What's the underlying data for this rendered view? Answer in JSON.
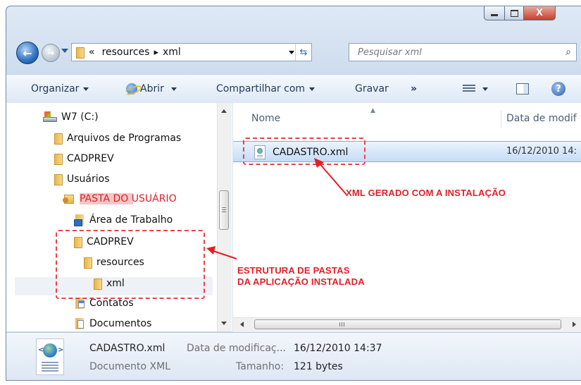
{
  "window": {
    "minimize_label": "–",
    "maximize_label": "□",
    "close_label": "X"
  },
  "address_bar": {
    "overflow": "«",
    "segments": [
      "resources",
      "xml"
    ],
    "search_placeholder": "Pesquisar xml"
  },
  "toolbar": {
    "organize": "Organizar",
    "open": "Abrir",
    "share": "Compartilhar com",
    "burn": "Gravar",
    "more": "»"
  },
  "nav_tree": [
    {
      "label": "W7 (C:)",
      "icon": "drive-icon",
      "level": 0
    },
    {
      "label": "Arquivos de Programas",
      "icon": "folder-icon",
      "level": 1
    },
    {
      "label": "CADPREV",
      "icon": "folder-icon",
      "level": 1
    },
    {
      "label": "Usuários",
      "icon": "folder-icon",
      "level": 1
    },
    {
      "label": "PASTA DO USUÁRIO",
      "icon": "user-folder-icon",
      "level": 2
    },
    {
      "label": "Área de Trabalho",
      "icon": "desktop-folder-icon",
      "level": 3
    },
    {
      "label": "CADPREV",
      "icon": "folder-icon",
      "level": 3
    },
    {
      "label": "resources",
      "icon": "folder-icon",
      "level": 4
    },
    {
      "label": "xml",
      "icon": "folder-icon",
      "level": 5
    },
    {
      "label": "Contatos",
      "icon": "contacts-folder-icon",
      "level": 3
    },
    {
      "label": "Documentos",
      "icon": "documents-folder-icon",
      "level": 3
    }
  ],
  "file_list": {
    "columns": [
      "Nome",
      "Data de modif"
    ],
    "rows": [
      {
        "name": "CADASTRO.xml",
        "date": "16/12/2010 14:"
      }
    ]
  },
  "details": {
    "name": "CADASTRO.xml",
    "type": "Documento XML",
    "date_label": "Data de modificaç...",
    "date_value": "16/12/2010 14:37",
    "size_label": "Tamanho:",
    "size_value": "121 bytes"
  },
  "annotations": {
    "file_note": "XML GERADO COM A INSTALAÇÃO",
    "folder_note_line1": "ESTRUTURA DE PASTAS",
    "folder_note_line2": "DA APLICAÇÃO INSTALADA",
    "color": "#e02027"
  },
  "colors": {
    "selection": "#c5dcf6",
    "user_folder_highlight": "#f4c6c6"
  }
}
